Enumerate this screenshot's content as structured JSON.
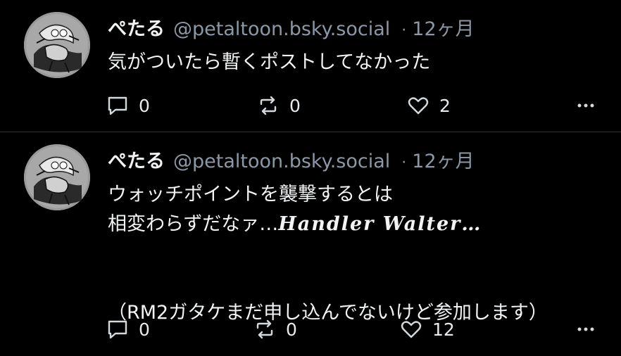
{
  "posts": [
    {
      "author_name": "ぺたる",
      "handle": "@petaltoon.bsky.social",
      "separator": "·",
      "time": "12ヶ月",
      "text": "気がついたら暫くポストしてなかった",
      "reply_count": "0",
      "repost_count": "0",
      "like_count": "2",
      "icons": [
        "avatar",
        "reply-icon",
        "repost-icon",
        "heart-icon",
        "more-icon"
      ]
    },
    {
      "author_name": "ぺたる",
      "handle": "@petaltoon.bsky.social",
      "separator": "·",
      "time": "12ヶ月",
      "text_line1": "ウォッチポイントを襲撃するとは",
      "text_line2_prefix": "相変わらずだなァ…",
      "text_line2_fancy": "Handler Walter…",
      "text_line3": "（RM2ガタケまだ申し込んでないけど参加します）",
      "reply_count": "0",
      "repost_count": "0",
      "like_count": "12",
      "icons": [
        "avatar",
        "reply-icon",
        "repost-icon",
        "heart-icon",
        "more-icon"
      ]
    }
  ],
  "colors": {
    "background": "#000000",
    "text": "#f1f3f5",
    "muted": "#8b98a5",
    "divider": "#2e3438"
  }
}
